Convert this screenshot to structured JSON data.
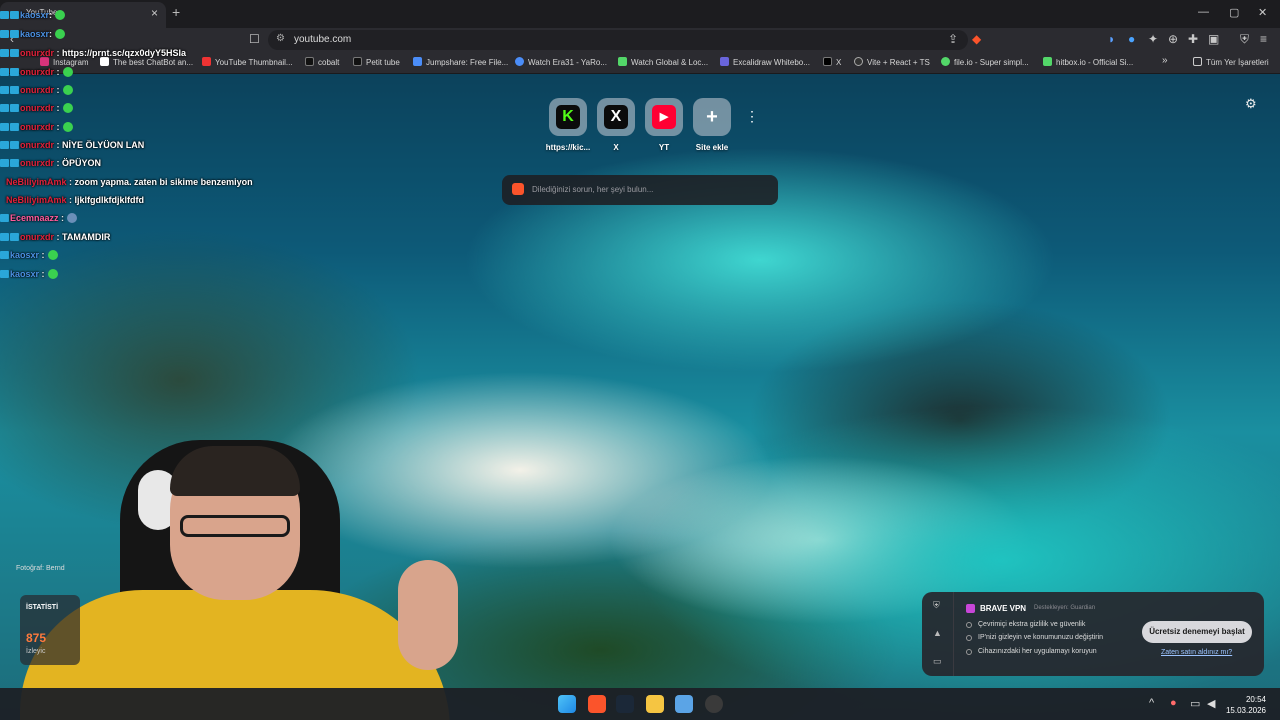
{
  "browser": {
    "tab_title": "YouTube",
    "url": "youtube.com",
    "bookmarks": [
      {
        "label": "Instagram",
        "color": "#d8337a"
      },
      {
        "label": "The best ChatBot an...",
        "color": "#ffffff"
      },
      {
        "label": "YouTube Thumbnail...",
        "color": "#e33"
      },
      {
        "label": "cobalt",
        "color": "#ffffff"
      },
      {
        "label": "Petit tube",
        "color": "#ffffff"
      },
      {
        "label": "Jumpshare: Free File...",
        "color": "#4b8df8"
      },
      {
        "label": "Watch Era31 - YaRo...",
        "color": "#4b8df8"
      },
      {
        "label": "Watch Global & Loc...",
        "color": "#53d769"
      },
      {
        "label": "Excalidraw Whitebo...",
        "color": "#6965db"
      },
      {
        "label": "X",
        "color": "#ffffff"
      },
      {
        "label": "Vite + React + TS",
        "color": "#ffffff"
      },
      {
        "label": "file.io - Super simpl...",
        "color": "#53d769"
      },
      {
        "label": "hitbox.io - Official Si...",
        "color": "#53d769"
      }
    ],
    "all_bookmarks_label": "Tüm Yer İşaretleri"
  },
  "newtab": {
    "shortcuts": [
      {
        "label": "https://kic...",
        "glyph": "K",
        "fg": "#53fc18",
        "bg": "#0b0b0b"
      },
      {
        "label": "X",
        "glyph": "X",
        "fg": "#ffffff",
        "bg": "#0b0b0b"
      },
      {
        "label": "YT",
        "glyph": "▶",
        "fg": "#ffffff",
        "bg": "#ff0033"
      },
      {
        "label": "Site ekle",
        "glyph": "+",
        "fg": "#ffffff",
        "bg": "transparent"
      }
    ],
    "search_placeholder": "Dilediğinizi sorun, her şeyi bulun..."
  },
  "chat": [
    {
      "user": "kaosxr",
      "color": "#4a90e2",
      "message": ""
    },
    {
      "user": "kaosxr",
      "color": "#4a90e2",
      "message": ""
    },
    {
      "user": "onurxdr",
      "color": "#e0213a",
      "message": "https://prnt.sc/qzx0dyY5HSIa"
    },
    {
      "user": "onurxdr",
      "color": "#e0213a",
      "message": ""
    },
    {
      "user": "onurxdr",
      "color": "#e0213a",
      "message": ""
    },
    {
      "user": "onurxdr",
      "color": "#e0213a",
      "message": ""
    },
    {
      "user": "onurxdr",
      "color": "#e0213a",
      "message": ""
    },
    {
      "user": "onurxdr",
      "color": "#e0213a",
      "message": "NİYE ÖLYÜON LAN"
    },
    {
      "user": "onurxdr",
      "color": "#e0213a",
      "message": "ÖPÜYON"
    },
    {
      "user": "NeBiliyimAmk",
      "color": "#e0213a",
      "message": "zoom yapma. zaten bi sikime benzemiyon"
    },
    {
      "user": "NeBiliyimAmk",
      "color": "#e0213a",
      "message": "ljklfgdlkfdjklfdfd"
    },
    {
      "user": "Ecemnaazz",
      "color": "#ff5a9b",
      "message": ""
    },
    {
      "user": "onurxdr",
      "color": "#e0213a",
      "message": "TAMAMDIR"
    },
    {
      "user": "kaosxr",
      "color": "#4a90e2",
      "message": ""
    },
    {
      "user": "kaosxr",
      "color": "#4a90e2",
      "message": ""
    }
  ],
  "overlay": {
    "photo_credit": "Fotoğraf: Bernd",
    "stats_title": "İSTATİSTİ",
    "stats_value": "875",
    "stats_sub": "İzleyic"
  },
  "vpn": {
    "title": "BRAVE VPN",
    "partner": "Destekleyen: Guardian",
    "features": [
      "Çevrimiçi ekstra gizlilik ve güvenlik",
      "IP'nizi gizleyin ve konumunuzu değiştirin",
      "Cihazınızdaki her uygulamayı koruyun"
    ],
    "cta": "Ücretsiz denemeyi başlat",
    "already_bought": "Zaten satın aldınız mı?"
  },
  "taskbar": {
    "time": "20:54",
    "date": "15.03.2026"
  }
}
